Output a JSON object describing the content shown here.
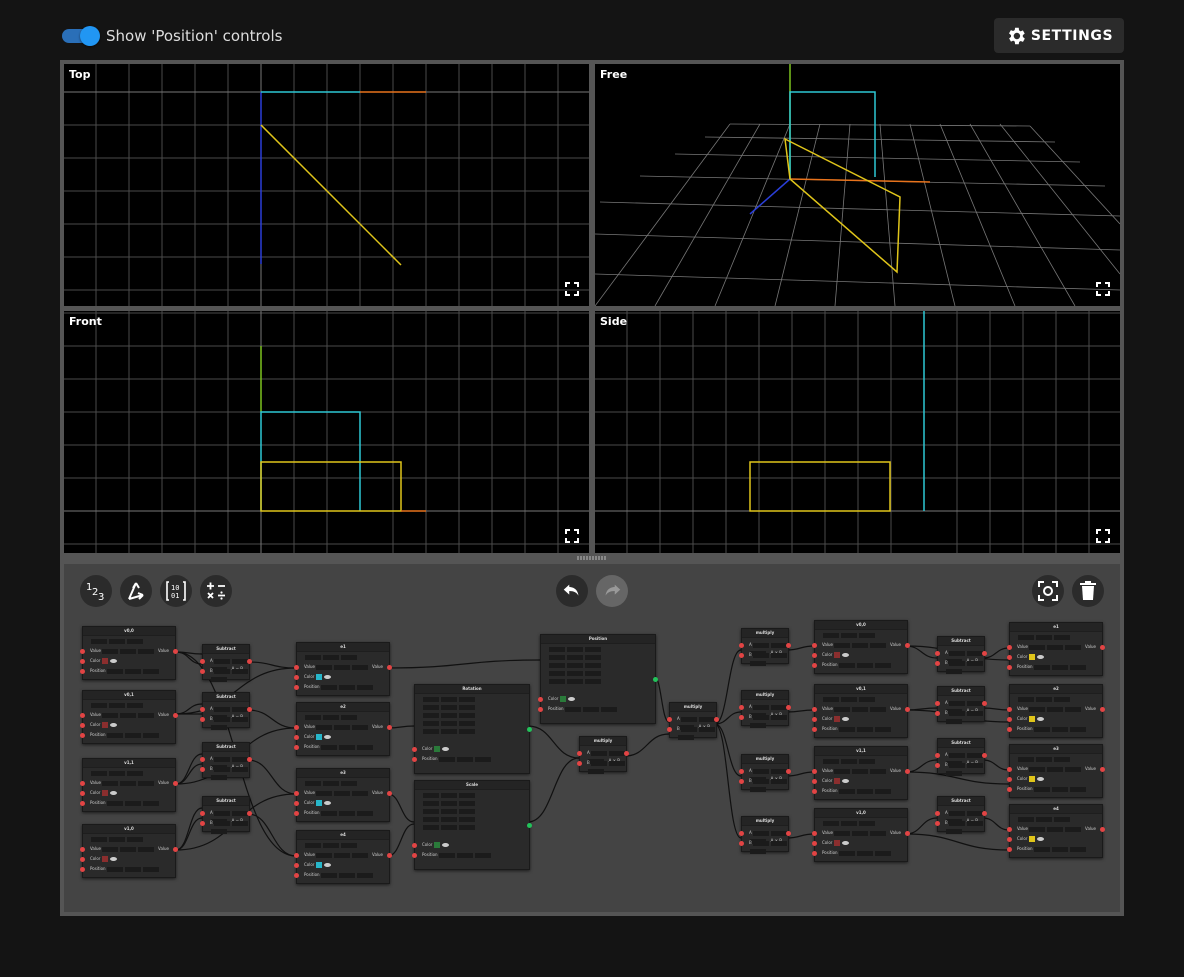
{
  "header": {
    "toggle_label": "Show 'Position' controls",
    "settings_label": "SETTINGS"
  },
  "viewports": {
    "top": "Top",
    "free": "Free",
    "front": "Front",
    "side": "Side"
  },
  "colors": {
    "x_axis": "#e8731c",
    "y_axis": "#7cc21f",
    "z_axis": "#2a3ed8",
    "cyan": "#2ec7d4",
    "yellow": "#e0c51a",
    "grid": "#4a4a4a"
  },
  "icons": {
    "toolbar": [
      "number-icon",
      "vector-icon",
      "matrix-icon",
      "operations-icon"
    ],
    "history": [
      "undo-icon",
      "redo-icon"
    ],
    "actions": [
      "screenshot-icon",
      "delete-icon"
    ]
  },
  "nodes": {
    "subtract": "Subtract",
    "multiply": "multiply",
    "rotation": "Rotation",
    "scale": "Scale",
    "position": "Position",
    "port_value": "Value",
    "port_color": "Color",
    "port_position": "Position",
    "port_a": "A",
    "port_b": "B",
    "op_sub": "A − B",
    "op_mul": "A × B",
    "left_vectors": [
      "v0,0",
      "v0,1",
      "v1,1",
      "v1,0"
    ],
    "mid_vectors": [
      "e1",
      "e2",
      "e3",
      "e4"
    ],
    "right_vectors": [
      "v0,0",
      "v0,1",
      "v1,1",
      "v1,0"
    ],
    "far_vectors": [
      "e1",
      "e2",
      "e3",
      "e4"
    ]
  }
}
